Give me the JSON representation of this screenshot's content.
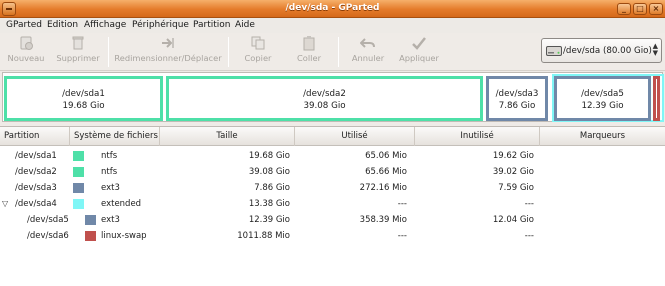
{
  "window": {
    "title": "/dev/sda - GParted"
  },
  "menubar": [
    "GParted",
    "Edition",
    "Affichage",
    "Périphérique",
    "Partition",
    "Aide"
  ],
  "toolbar": {
    "new": "Nouveau",
    "delete": "Supprimer",
    "resize": "Redimensionner/Déplacer",
    "copy": "Copier",
    "paste": "Coller",
    "undo": "Annuler",
    "apply": "Appliquer"
  },
  "device_selector": {
    "label": "/dev/sda  (80.00 Gio)"
  },
  "map": {
    "sda1": {
      "name": "/dev/sda1",
      "size": "19.68 Gio",
      "color": "#4ee0a8"
    },
    "sda2": {
      "name": "/dev/sda2",
      "size": "39.08 Gio",
      "color": "#4ee0a8"
    },
    "sda3": {
      "name": "/dev/sda3",
      "size": "7.86 Gio",
      "color": "#7088a8"
    },
    "sda5": {
      "name": "/dev/sda5",
      "size": "12.39 Gio",
      "color": "#7088a8"
    },
    "sda6": {
      "color": "#c0504d"
    },
    "extended_color": "#7ff6f6"
  },
  "table": {
    "headers": [
      "Partition",
      "Système de fichiers",
      "Taille",
      "Utilisé",
      "Inutilisé",
      "Marqueurs"
    ],
    "rows": [
      {
        "partition": "/dev/sda1",
        "fs": "ntfs",
        "size": "19.68 Gio",
        "used": "65.06 Mio",
        "unused": "19.62 Gio",
        "flags": "",
        "color": "#4ee0a8"
      },
      {
        "partition": "/dev/sda2",
        "fs": "ntfs",
        "size": "39.08 Gio",
        "used": "65.66 Mio",
        "unused": "39.02 Gio",
        "flags": "",
        "color": "#4ee0a8"
      },
      {
        "partition": "/dev/sda3",
        "fs": "ext3",
        "size": "7.86 Gio",
        "used": "272.16 Mio",
        "unused": "7.59 Gio",
        "flags": "",
        "color": "#7088a8"
      },
      {
        "partition": "/dev/sda4",
        "fs": "extended",
        "size": "13.38 Gio",
        "used": "---",
        "unused": "---",
        "flags": "",
        "color": "#7ff6f6"
      },
      {
        "partition": "/dev/sda5",
        "fs": "ext3",
        "size": "12.39 Gio",
        "used": "358.39 Mio",
        "unused": "12.04 Gio",
        "flags": "",
        "color": "#7088a8"
      },
      {
        "partition": "/dev/sda6",
        "fs": "linux-swap",
        "size": "1011.88 Mio",
        "used": "---",
        "unused": "---",
        "flags": "",
        "color": "#c0504d"
      }
    ]
  }
}
